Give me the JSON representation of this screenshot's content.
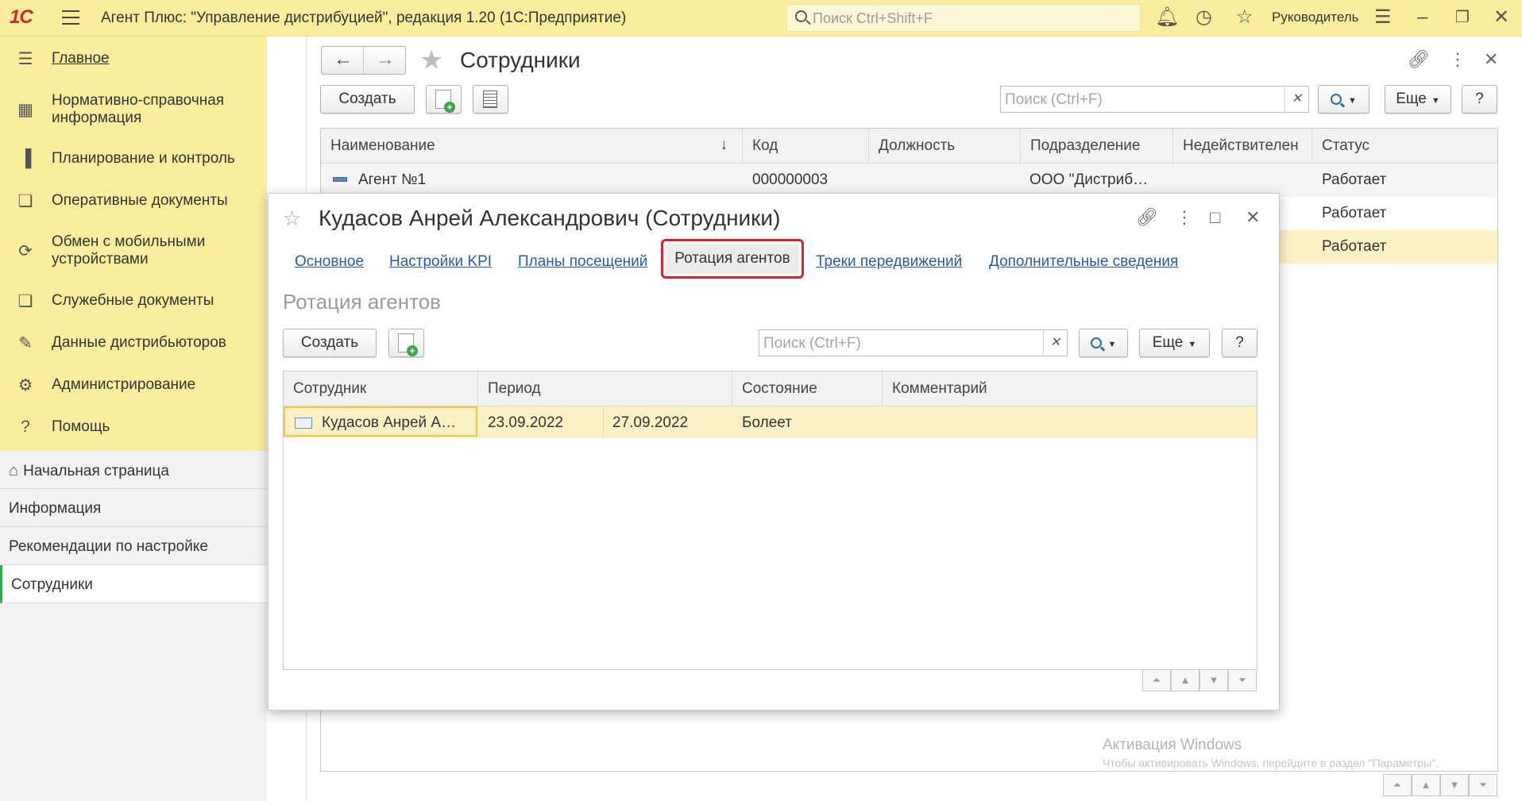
{
  "app": {
    "logo": "1С",
    "title": "Агент Плюс: \"Управление дистрибуцией\", редакция 1.20  (1С:Предприятие)",
    "search_placeholder": "Поиск Ctrl+Shift+F",
    "user": "Руководитель"
  },
  "sidebar": {
    "items": [
      {
        "label": "Главное",
        "icon": "menu-lines-icon"
      },
      {
        "label": "Нормативно-справочная информация",
        "icon": "grid-icon"
      },
      {
        "label": "Планирование и контроль",
        "icon": "bar-chart-icon"
      },
      {
        "label": "Оперативные документы",
        "icon": "documents-icon"
      },
      {
        "label": "Обмен с мобильными устройствами",
        "icon": "sync-icon"
      },
      {
        "label": "Служебные документы",
        "icon": "documents-icon"
      },
      {
        "label": "Данные дистрибьюторов",
        "icon": "document-edit-icon"
      },
      {
        "label": "Администрирование",
        "icon": "gear-icon"
      },
      {
        "label": "Помощь",
        "icon": "question-icon"
      }
    ]
  },
  "navlist": {
    "items": [
      "Начальная страница",
      "Информация",
      "Рекомендации по настройке",
      "Сотрудники"
    ],
    "selected": "Сотрудники"
  },
  "main": {
    "title": "Сотрудники",
    "create_label": "Создать",
    "search_placeholder": "Поиск (Ctrl+F)",
    "more_label": "Еще",
    "help_label": "?",
    "columns": [
      "Наименование",
      "Код",
      "Должность",
      "Подразделение",
      "Недействителен",
      "Статус"
    ],
    "sort_indicator": "↓",
    "rows": [
      {
        "name": "Агент №1",
        "code": "000000003",
        "position": "",
        "department": "ООО \"Дистриб…",
        "invalid": "",
        "status": "Работает"
      },
      {
        "status": "Работает"
      },
      {
        "status": "Работает"
      }
    ]
  },
  "modal": {
    "title": "Кудасов Анрей Александрович (Сотрудники)",
    "tabs": [
      "Основное",
      "Настройки KPI",
      "Планы посещений",
      "Ротация агентов",
      "Треки передвижений",
      "Дополнительные сведения"
    ],
    "active_tab": "Ротация агентов",
    "page_title": "Ротация агентов",
    "create_label": "Создать",
    "search_placeholder": "Поиск (Ctrl+F)",
    "more_label": "Еще",
    "help_label": "?",
    "columns": [
      "Сотрудник",
      "Период",
      "Состояние",
      "Комментарий"
    ],
    "rows": [
      {
        "employee": "Кудасов Анрей А…",
        "period_start": "23.09.2022",
        "period_end": "27.09.2022",
        "state": "Болеет",
        "comment": ""
      }
    ]
  },
  "watermark": {
    "line1": "Активация Windows",
    "line2": "Чтобы активировать Windows, перейдите в раздел \"Параметры\"."
  },
  "colors": {
    "accent_yellow": "#fbed9e",
    "link_blue": "#2a5d9f",
    "highlight_red": "#d9232e",
    "selected_row": "#fcf1c4",
    "logo_red": "#d4242b"
  }
}
